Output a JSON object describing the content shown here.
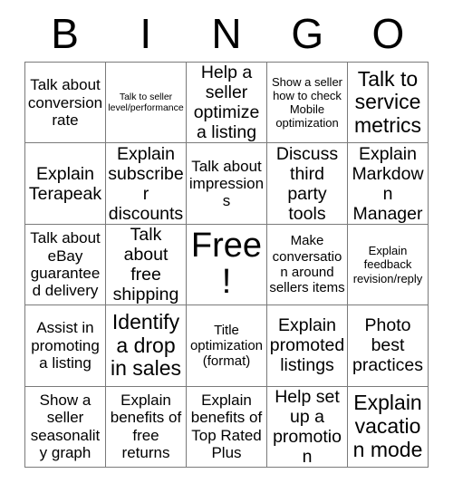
{
  "header": {
    "letters": [
      "B",
      "I",
      "N",
      "G",
      "O"
    ]
  },
  "grid": {
    "rows": [
      [
        "Talk about conversion rate",
        "Talk to seller level/performance",
        "Help a seller optimize a listing",
        "Show a seller how to check Mobile optimization",
        "Talk to service metrics"
      ],
      [
        "Explain Terapeak",
        "Explain subscriber discounts",
        "Talk about impressions",
        "Discuss third party tools",
        "Explain Markdown Manager"
      ],
      [
        "Talk about eBay guaranteed delivery",
        "Talk about free shipping",
        "Free!",
        "Make conversation around sellers items",
        "Explain feedback revision/reply"
      ],
      [
        "Assist in promoting a listing",
        "Identify a drop in sales",
        "Title optimization (format)",
        "Explain promoted listings",
        "Photo best practices"
      ],
      [
        "Show a seller seasonality graph",
        "Explain benefits of free returns",
        "Explain benefits of Top Rated Plus",
        "Help set up a promotion",
        "Explain vacation mode"
      ]
    ]
  },
  "colors": {
    "background": "#ffffff",
    "text": "#000000",
    "grid_line": "#7a7a7a"
  }
}
